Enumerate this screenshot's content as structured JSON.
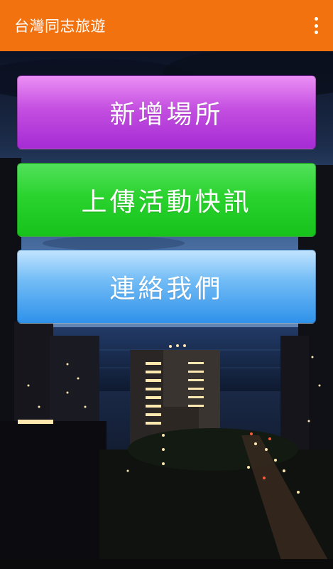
{
  "app_bar": {
    "title": "台灣同志旅遊",
    "menu_icon": "more-vertical-icon",
    "color": "#f2720f"
  },
  "buttons": {
    "add_place": "新增場所",
    "upload_news": "上傳活動快訊",
    "contact_us": "連絡我們"
  },
  "colors": {
    "add_place": "#b444dc",
    "upload_news": "#26cc2b",
    "contact_us": "#5aaaf2"
  },
  "background": {
    "description_icon": "night-city-photo"
  }
}
